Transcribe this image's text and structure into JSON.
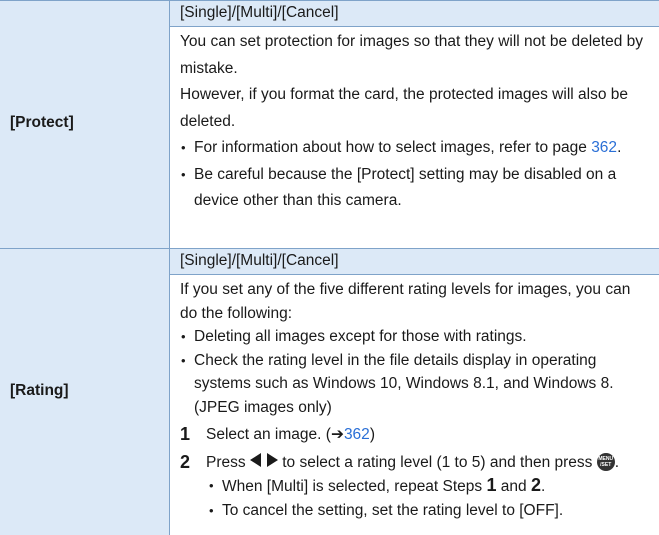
{
  "protect": {
    "label": "[Protect]",
    "options": "[Single]/[Multi]/[Cancel]",
    "desc_1": "You can set protection for images so that they will not be deleted by mistake.",
    "desc_2": "However, if you format the card, the protected images will also be deleted.",
    "bullet_1_text": "For information about how to select images, refer to page ",
    "bullet_1_link": "362",
    "bullet_1_end": ".",
    "bullet_2": "Be careful because the [Protect] setting may be disabled on a device other than this camera."
  },
  "rating": {
    "label": "[Rating]",
    "options": "[Single]/[Multi]/[Cancel]",
    "desc_1": "If you set any of the five different rating levels for images, you can do the following:",
    "bullet_1": "Deleting all images except for those with ratings.",
    "bullet_2": "Check the rating level in the file details display in operating systems such as Windows 10, Windows 8.1, and Windows 8. (JPEG images only)",
    "step_1_num": "1",
    "step_1_text": "Select an image. (",
    "step_1_arrow": "➔",
    "step_1_link": "362",
    "step_1_end": ")",
    "step_2_num": "2",
    "step_2_text_a": "Press ",
    "step_2_text_b": " to select a rating level (1 to 5) and then press ",
    "step_2_text_c": ".",
    "menu_set_top": "MENU",
    "menu_set_bottom": "/SET",
    "sub_1_a": "When [Multi] is selected, repeat Steps ",
    "sub_1_n1": "1",
    "sub_1_b": " and ",
    "sub_1_n2": "2",
    "sub_1_c": ".",
    "sub_2": "To cancel the setting, set the rating level to [OFF]."
  },
  "colors": {
    "header_bg": "#dce9f7",
    "border": "#7fa3c9",
    "link": "#2a6fd6"
  }
}
